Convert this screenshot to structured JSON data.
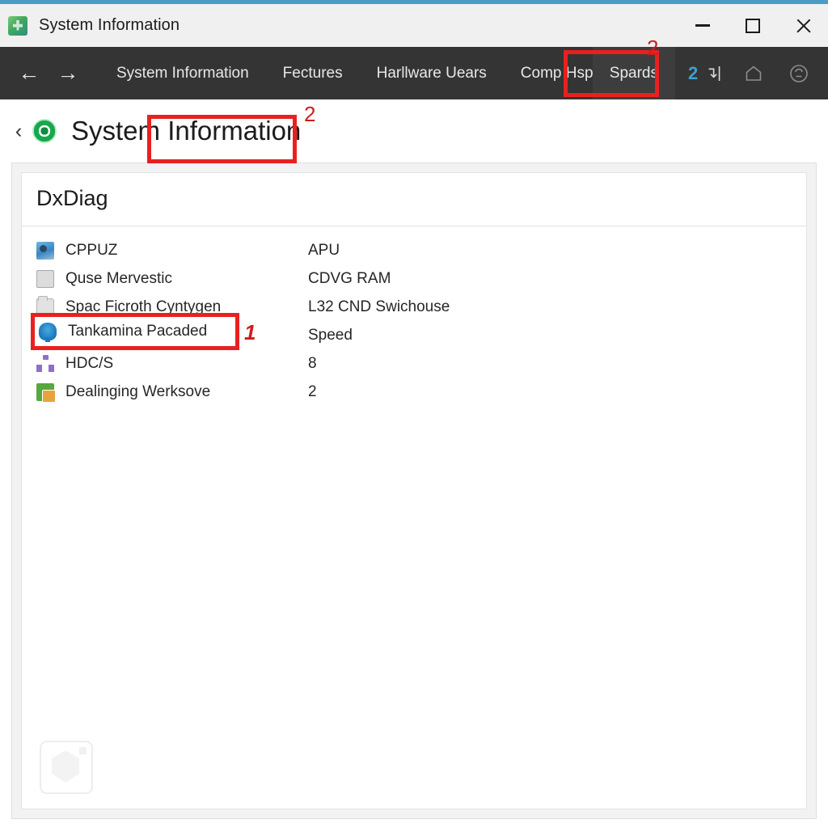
{
  "window": {
    "title": "System Information",
    "app_icon": "system-information-icon",
    "accent_color": "#4a9cc4",
    "controls": [
      {
        "name": "minimize-button",
        "glyph": "minimize-icon"
      },
      {
        "name": "maximize-button",
        "glyph": "maximize-icon"
      },
      {
        "name": "close-button",
        "glyph": "close-icon"
      }
    ]
  },
  "toolbar": {
    "background_color": "#343434",
    "back_arrow": "←",
    "forward_arrow": "→",
    "items": [
      {
        "label": "System Information",
        "active": false
      },
      {
        "label": "Fectures",
        "active": false
      },
      {
        "label": "Harllware Uears",
        "active": false
      },
      {
        "label": "Comp Hsp",
        "active": false,
        "clipped": true
      },
      {
        "label": "Spards",
        "active": true
      }
    ],
    "badge": "2",
    "badge_color": "#3f9fd4",
    "mini_icon": "↴|",
    "right_icons": [
      {
        "name": "home-icon",
        "glyph": "⌂"
      },
      {
        "name": "help-circle-icon",
        "glyph": "⊙"
      }
    ]
  },
  "page": {
    "back_chevron": "‹",
    "status_icon": "green-target-icon",
    "title": "System Information"
  },
  "card": {
    "title": "DxDiag",
    "rows": [
      {
        "icon": "monitor-icon",
        "label": "CPPUZ",
        "value": "APU"
      },
      {
        "icon": "square-icon",
        "label": "Quse Mervestic",
        "value": "CDVG RAM"
      },
      {
        "icon": "folder-icon",
        "label": "Spac Ficroth Cyntygen",
        "value": "L32 CND Swichouse"
      },
      {
        "icon": "chip-icon",
        "label": "Tankamina Pacaded",
        "value": "Speed"
      },
      {
        "icon": "network-icon",
        "label": "HDC/S",
        "value": "8"
      },
      {
        "icon": "apps-icon",
        "label": "Dealinging Werksove",
        "value": "2"
      }
    ]
  },
  "annotations": {
    "color": "#e8211f",
    "number_color": "#cf1c1c",
    "marks": [
      {
        "name": "annotation-1-list-item",
        "number": "1",
        "target": "Tankamina Pacaded"
      },
      {
        "name": "annotation-2-page-title",
        "number": "2",
        "target": "Information"
      },
      {
        "name": "annotation-2-toolbar-tab",
        "number": "2",
        "target": "Spards"
      }
    ]
  },
  "watermark": {
    "name": "placeholder-watermark-icon"
  }
}
